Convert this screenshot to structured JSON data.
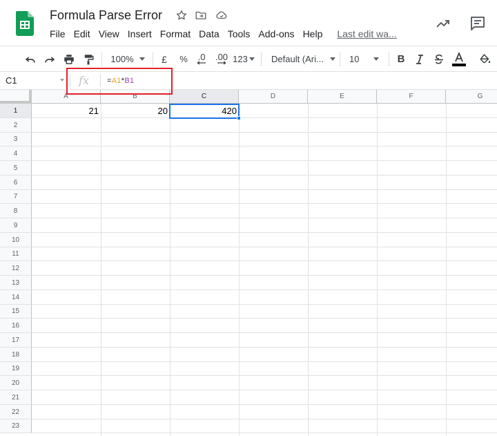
{
  "document": {
    "title": "Formula Parse Error"
  },
  "menu": [
    "File",
    "Edit",
    "View",
    "Insert",
    "Format",
    "Data",
    "Tools",
    "Add-ons",
    "Help"
  ],
  "last_edit": "Last edit wa...",
  "toolbar": {
    "zoom": "100%",
    "currency": "£",
    "percent": "%",
    "decrease_decimals": ".0",
    "increase_decimals": ".00",
    "more_formats": "123",
    "font": "Default (Ari...",
    "font_size": "10",
    "bold": "B"
  },
  "formula_bar": {
    "name_box": "C1",
    "fx": "fx",
    "formula": {
      "eq": "=",
      "ref1": "A1",
      "op": "*",
      "ref2": "B1"
    }
  },
  "grid": {
    "columns": [
      "A",
      "B",
      "C",
      "D",
      "E",
      "F",
      "G"
    ],
    "rows": [
      "1",
      "2",
      "3",
      "4",
      "5",
      "6",
      "7",
      "8",
      "9",
      "10",
      "11",
      "12",
      "13",
      "14",
      "15",
      "16",
      "17",
      "18",
      "19",
      "20",
      "21",
      "22",
      "23"
    ],
    "cells": {
      "A1": "21",
      "B1": "20",
      "C1": "420"
    },
    "active_cell": "C1"
  },
  "colors": {
    "selection": "#1a73e8",
    "highlight_box": "#e3202a",
    "ref1": "#e8a317",
    "ref2": "#a142b0",
    "sheets_green": "#0f9d58"
  }
}
